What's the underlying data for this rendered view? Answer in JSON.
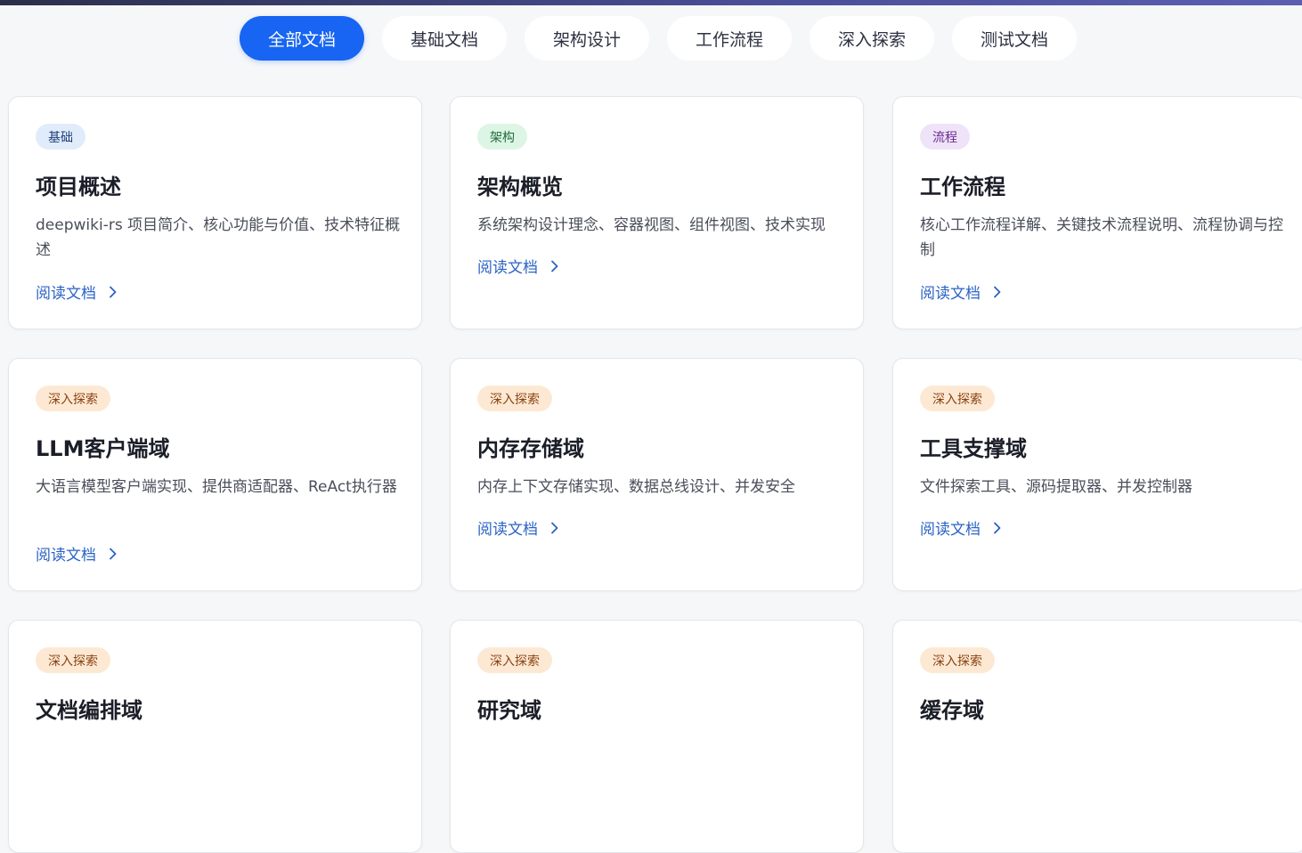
{
  "filters": [
    {
      "label": "全部文档",
      "active": true
    },
    {
      "label": "基础文档",
      "active": false
    },
    {
      "label": "架构设计",
      "active": false
    },
    {
      "label": "工作流程",
      "active": false
    },
    {
      "label": "深入探索",
      "active": false
    },
    {
      "label": "测试文档",
      "active": false
    }
  ],
  "read_label": "阅读文档",
  "cards": [
    {
      "tag": "基础",
      "title": "项目概述",
      "desc": "deepwiki-rs 项目简介、核心功能与价值、技术特征概述"
    },
    {
      "tag": "架构",
      "title": "架构概览",
      "desc": "系统架构设计理念、容器视图、组件视图、技术实现"
    },
    {
      "tag": "流程",
      "title": "工作流程",
      "desc": "核心工作流程详解、关键技术流程说明、流程协调与控制"
    },
    {
      "tag": "深入探索",
      "title": "LLM客户端域",
      "desc": "大语言模型客户端实现、提供商适配器、ReAct执行器"
    },
    {
      "tag": "深入探索",
      "title": "内存存储域",
      "desc": "内存上下文存储实现、数据总线设计、并发安全"
    },
    {
      "tag": "深入探索",
      "title": "工具支撑域",
      "desc": "文件探索工具、源码提取器、并发控制器"
    },
    {
      "tag": "深入探索",
      "title": "文档编排域",
      "desc": ""
    },
    {
      "tag": "深入探索",
      "title": "研究域",
      "desc": ""
    },
    {
      "tag": "深入探索",
      "title": "缓存域",
      "desc": ""
    }
  ],
  "colors": {
    "accent": "#1765f2",
    "link": "#2b63c4",
    "tag_basic_bg": "#e1ecfb",
    "tag_arch_bg": "#ddf5e5",
    "tag_flow_bg": "#efe3f9",
    "tag_deep_bg": "#fde9d3"
  }
}
